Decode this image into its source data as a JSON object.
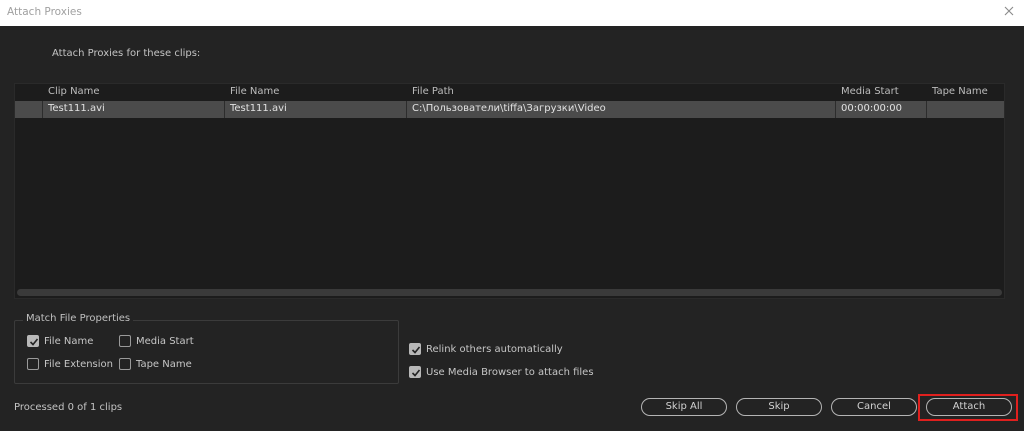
{
  "window": {
    "title": "Attach Proxies",
    "close_icon": "close-icon"
  },
  "instruction": "Attach Proxies for these clips:",
  "table": {
    "columns": [
      "Clip Name",
      "File Name",
      "File Path",
      "Media Start",
      "Tape Name"
    ],
    "rows": [
      {
        "clip_name": "Test111.avi",
        "file_name": "Test111.avi",
        "file_path": "C:\\Пользователи\\tiffa\\Загрузки\\Video",
        "media_start": "00:00:00:00",
        "tape_name": ""
      }
    ]
  },
  "match_group": {
    "label": "Match File Properties",
    "file_name": {
      "label": "File Name",
      "checked": true
    },
    "media_start": {
      "label": "Media Start",
      "checked": false
    },
    "file_extension": {
      "label": "File Extension",
      "checked": false
    },
    "tape_name": {
      "label": "Tape Name",
      "checked": false
    }
  },
  "relink": {
    "label": "Relink others automatically",
    "checked": true
  },
  "media_browser": {
    "label": "Use Media Browser to attach files",
    "checked": true
  },
  "status": "Processed 0 of 1 clips",
  "buttons": {
    "skip_all": "Skip All",
    "skip": "Skip",
    "cancel": "Cancel",
    "attach": "Attach"
  },
  "colors": {
    "background": "#232323",
    "selected_row": "#4b4b4b",
    "highlight": "#e0201e"
  }
}
